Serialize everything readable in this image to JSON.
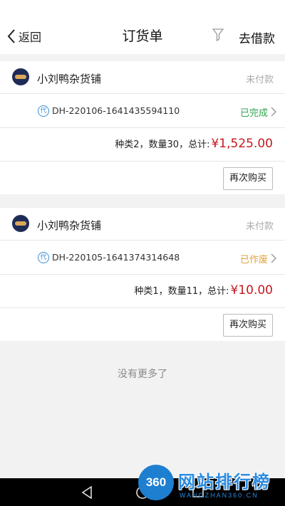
{
  "header": {
    "back_label": "返回",
    "title": "订货单",
    "right_label": "去借款"
  },
  "orders": [
    {
      "shop_name": "小刘鸭杂货铺",
      "payment_status": "未付款",
      "badge": "代",
      "order_no": "DH-220106-1641435594110",
      "order_status": "已完成",
      "summary_prefix": "种类2，数量30，总计:",
      "total": "¥1,525.00",
      "button_label": "再次购买"
    },
    {
      "shop_name": "小刘鸭杂货铺",
      "payment_status": "未付款",
      "badge": "代",
      "order_no": "DH-220105-1641374314648",
      "order_status": "已作废",
      "summary_prefix": "种类1，数量11，总计:",
      "total": "¥10.00",
      "button_label": "再次购买"
    }
  ],
  "footer_text": "没有更多了",
  "watermark": {
    "logo": "360",
    "text": "网站排行榜",
    "sub": "WANGZHAN360.CN"
  },
  "colors": {
    "completed": "#2ea44f",
    "voided": "#e0a33a",
    "total": "#c4191f"
  }
}
